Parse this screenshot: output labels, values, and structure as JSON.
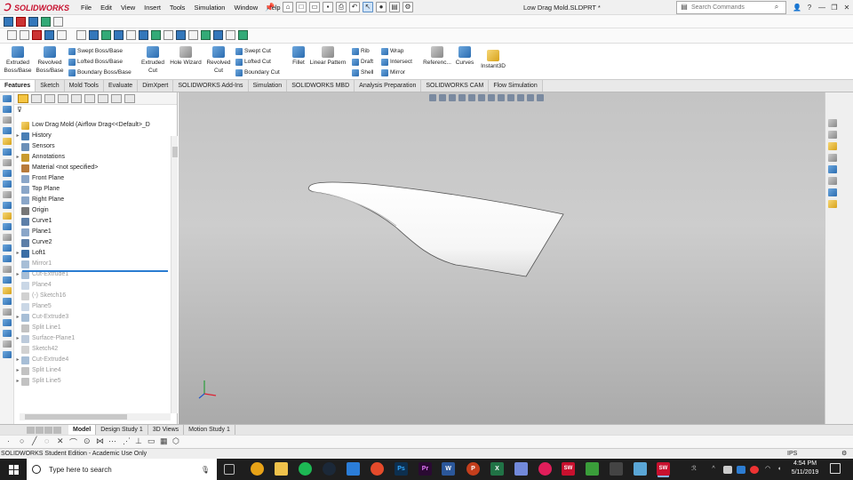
{
  "app": {
    "brand": "SOLIDWORKS",
    "document_title": "Low Drag Mold.SLDPRT *"
  },
  "menu": [
    "File",
    "Edit",
    "View",
    "Insert",
    "Tools",
    "Simulation",
    "Window",
    "Help"
  ],
  "search": {
    "placeholder": "Search Commands"
  },
  "window_controls": {
    "minimize": "—",
    "restore": "❐",
    "close": "✕"
  },
  "command_manager": {
    "extruded_boss": "Extruded Boss/Base",
    "revolved_boss": "Revolved Boss/Base",
    "swept_boss": "Swept Boss/Base",
    "lofted_boss": "Lofted Boss/Base",
    "boundary_boss": "Boundary Boss/Base",
    "extruded_cut": "Extruded Cut",
    "hole_wizard": "Hole Wizard",
    "revolved_cut": "Revolved Cut",
    "swept_cut": "Swept Cut",
    "lofted_cut": "Lofted Cut",
    "boundary_cut": "Boundary Cut",
    "fillet": "Fillet",
    "linear_pattern": "Linear Pattern",
    "rib": "Rib",
    "draft": "Draft",
    "shell": "Shell",
    "wrap": "Wrap",
    "intersect": "Intersect",
    "mirror": "Mirror",
    "reference": "Referenc...",
    "curves": "Curves",
    "instant3d": "Instant3D"
  },
  "tabs": [
    "Features",
    "Sketch",
    "Mold Tools",
    "Evaluate",
    "DimXpert",
    "SOLIDWORKS Add-Ins",
    "Simulation",
    "SOLIDWORKS MBD",
    "Analysis Preparation",
    "SOLIDWORKS CAM",
    "Flow Simulation"
  ],
  "feature_tree": {
    "root": "Low Drag Mold  (Airflow Drag<<Default>_D",
    "items": [
      {
        "label": "History",
        "expand": true,
        "dim": false,
        "color": "#4a7fb5"
      },
      {
        "label": "Sensors",
        "expand": false,
        "dim": false,
        "color": "#6b8fb8"
      },
      {
        "label": "Annotations",
        "expand": true,
        "dim": false,
        "color": "#c99a2e"
      },
      {
        "label": "Material <not specified>",
        "expand": false,
        "dim": false,
        "color": "#b87b3a"
      },
      {
        "label": "Front Plane",
        "expand": false,
        "dim": false,
        "color": "#8aa6c8"
      },
      {
        "label": "Top Plane",
        "expand": false,
        "dim": false,
        "color": "#8aa6c8"
      },
      {
        "label": "Right Plane",
        "expand": false,
        "dim": false,
        "color": "#8aa6c8"
      },
      {
        "label": "Origin",
        "expand": false,
        "dim": false,
        "color": "#777777"
      },
      {
        "label": "Curve1",
        "expand": false,
        "dim": false,
        "color": "#5d7fa8"
      },
      {
        "label": "Plane1",
        "expand": false,
        "dim": false,
        "color": "#8aa6c8"
      },
      {
        "label": "Curve2",
        "expand": false,
        "dim": false,
        "color": "#5d7fa8"
      },
      {
        "label": "Loft1",
        "expand": true,
        "dim": false,
        "color": "#3b6ea5"
      },
      {
        "label": "Mirror1",
        "expand": false,
        "dim": true,
        "color": "#3b6ea5"
      },
      {
        "label": "Cut-Extrude1",
        "expand": true,
        "dim": true,
        "color": "#3b6ea5"
      },
      {
        "label": "Plane4",
        "expand": false,
        "dim": true,
        "color": "#8aa6c8"
      },
      {
        "label": "(-) Sketch16",
        "expand": false,
        "dim": true,
        "color": "#999999"
      },
      {
        "label": "Plane5",
        "expand": false,
        "dim": true,
        "color": "#8aa6c8"
      },
      {
        "label": "Cut-Extrude3",
        "expand": true,
        "dim": true,
        "color": "#3b6ea5"
      },
      {
        "label": "Split Line1",
        "expand": false,
        "dim": true,
        "color": "#777777"
      },
      {
        "label": "Surface-Plane1",
        "expand": true,
        "dim": true,
        "color": "#6a8ab0"
      },
      {
        "label": "Sketch42",
        "expand": false,
        "dim": true,
        "color": "#999999"
      },
      {
        "label": "Cut-Extrude4",
        "expand": true,
        "dim": true,
        "color": "#3b6ea5"
      },
      {
        "label": "Split Line4",
        "expand": true,
        "dim": true,
        "color": "#777777"
      },
      {
        "label": "Split Line5",
        "expand": true,
        "dim": true,
        "color": "#777777"
      }
    ]
  },
  "bottom_tabs": [
    "Model",
    "Design Study 1",
    "3D Views",
    "Motion Study 1"
  ],
  "status": {
    "left": "SOLIDWORKS Student Edition - Academic Use Only",
    "units": "IPS"
  },
  "taskbar": {
    "search_placeholder": "Type here to search",
    "time": "4:54 PM",
    "date": "5/11/2019"
  },
  "colors": {
    "accent": "#2a7cd1",
    "brand": "#c8102e",
    "taskbar": "#1e1e1e"
  }
}
